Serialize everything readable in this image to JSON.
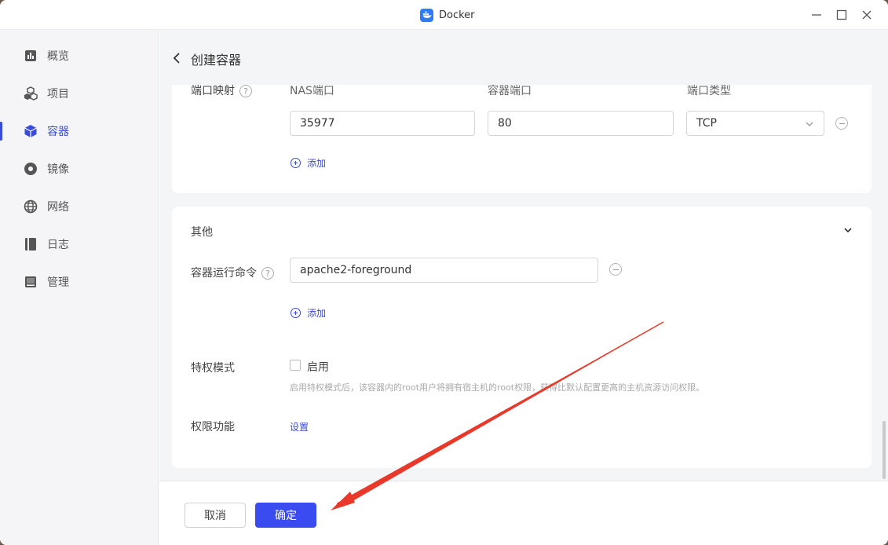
{
  "window": {
    "title": "Docker"
  },
  "sidebar": {
    "items": [
      {
        "label": "概览",
        "icon": "chart-icon"
      },
      {
        "label": "项目",
        "icon": "cubes-icon"
      },
      {
        "label": "容器",
        "icon": "cube-icon",
        "active": true
      },
      {
        "label": "镜像",
        "icon": "disc-icon"
      },
      {
        "label": "网络",
        "icon": "globe-icon"
      },
      {
        "label": "日志",
        "icon": "book-icon"
      },
      {
        "label": "管理",
        "icon": "manage-icon"
      }
    ]
  },
  "header": {
    "title": "创建容器"
  },
  "ports": {
    "label": "端口映射",
    "help": "?",
    "col_nas": "NAS端口",
    "col_container": "容器端口",
    "col_type": "端口类型",
    "nas_port": "35977",
    "container_port": "80",
    "type": "TCP",
    "add": "添加"
  },
  "other": {
    "title": "其他",
    "cmd_label": "容器运行命令",
    "help": "?",
    "cmd_value": "apache2-foreground",
    "add": "添加",
    "privileged_label": "特权模式",
    "privileged_option": "启用",
    "privileged_checked": false,
    "privileged_hint": "启用特权模式后，该容器内的root用户将拥有宿主机的root权限，获得比默认配置更高的主机资源访问权限。",
    "cap_label": "权限功能",
    "cap_link": "设置"
  },
  "footer": {
    "cancel": "取消",
    "ok": "确定"
  },
  "colors": {
    "accent": "#3a4bf0",
    "annotation_arrow": "#e8392a"
  }
}
